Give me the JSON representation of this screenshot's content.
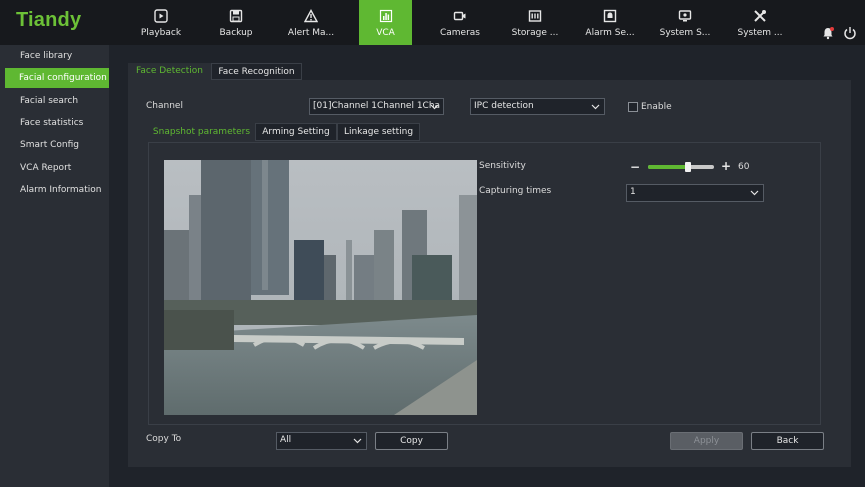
{
  "brand": {
    "logo_text": "Tiandy",
    "accent_color": "#5fb832"
  },
  "topnav": {
    "items": [
      {
        "label": "Playback",
        "icon": "playback-icon"
      },
      {
        "label": "Backup",
        "icon": "backup-icon"
      },
      {
        "label": "Alert Ma...",
        "icon": "alert-icon"
      },
      {
        "label": "VCA",
        "icon": "vca-icon",
        "active": true
      },
      {
        "label": "Cameras",
        "icon": "camera-icon"
      },
      {
        "label": "Storage ...",
        "icon": "storage-icon"
      },
      {
        "label": "Alarm Se...",
        "icon": "alarm-settings-icon"
      },
      {
        "label": "System S...",
        "icon": "system-status-icon"
      },
      {
        "label": "System ...",
        "icon": "system-tools-icon"
      }
    ],
    "right_icons": [
      "bell-icon",
      "power-icon"
    ]
  },
  "sidebar": {
    "items": [
      {
        "label": "Face library"
      },
      {
        "label": "Facial configuration",
        "active": true
      },
      {
        "label": "Facial search"
      },
      {
        "label": "Face statistics"
      },
      {
        "label": "Smart Config"
      },
      {
        "label": "VCA Report"
      },
      {
        "label": "Alarm Information"
      }
    ]
  },
  "main": {
    "tabs": [
      {
        "label": "Face Detection",
        "active": true
      },
      {
        "label": "Face Recognition"
      }
    ],
    "channel": {
      "label": "Channel",
      "value": "[01]Channel 1Channel 1Cha",
      "detection_mode": "IPC detection",
      "enable_label": "Enable",
      "enable_checked": false
    },
    "subtabs": [
      {
        "label": "Snapshot parameters",
        "active": true
      },
      {
        "label": "Arming Setting"
      },
      {
        "label": "Linkage setting"
      }
    ],
    "sensitivity": {
      "label": "Sensitivity",
      "value": 60,
      "minus": "−",
      "plus": "+"
    },
    "capturing_times": {
      "label": "Capturing times",
      "value": "1"
    },
    "copy_to": {
      "label": "Copy To",
      "value": "All",
      "copy_button": "Copy"
    },
    "buttons": {
      "apply": "Apply",
      "back": "Back"
    }
  }
}
